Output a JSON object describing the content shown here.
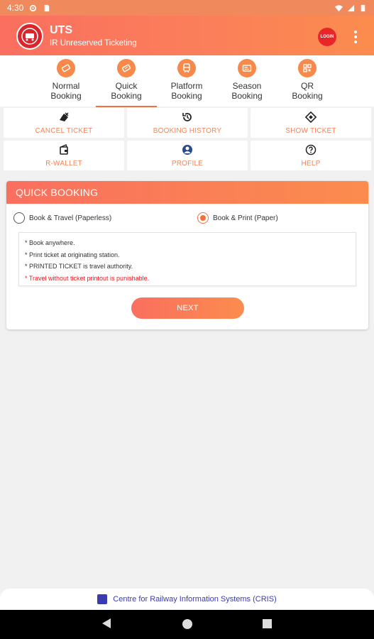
{
  "status_bar": {
    "time": "4:30",
    "icons": [
      "settings-icon",
      "sd-card-icon",
      "wifi-icon",
      "signal-icon",
      "battery-icon"
    ]
  },
  "app_bar": {
    "title": "UTS",
    "subtitle": "IR Unreserved Ticketing",
    "login_label": "LOGIN",
    "logo_icon": "indian-railways-logo",
    "more_icon": "more-vert-icon"
  },
  "tabs": [
    {
      "label": "Normal Booking",
      "line1": "Normal",
      "line2": "Booking",
      "icon": "ticket-icon",
      "active": false
    },
    {
      "label": "Quick Booking",
      "line1": "Quick",
      "line2": "Booking",
      "icon": "quick-ticket-icon",
      "active": true
    },
    {
      "label": "Platform Booking",
      "line1": "Platform",
      "line2": "Booking",
      "icon": "train-icon",
      "active": false
    },
    {
      "label": "Season Booking",
      "line1": "Season",
      "line2": "Booking",
      "icon": "season-card-icon",
      "active": false
    },
    {
      "label": "QR Booking",
      "line1": "QR",
      "line2": "Booking",
      "icon": "qr-code-icon",
      "active": false
    }
  ],
  "actions": [
    {
      "label": "CANCEL TICKET",
      "icon": "cancel-ticket-icon"
    },
    {
      "label": "BOOKING HISTORY",
      "icon": "history-icon"
    },
    {
      "label": "SHOW TICKET",
      "icon": "show-ticket-icon"
    },
    {
      "label": "R-WALLET",
      "icon": "wallet-icon"
    },
    {
      "label": "PROFILE",
      "icon": "profile-icon"
    },
    {
      "label": "HELP",
      "icon": "help-icon"
    }
  ],
  "quick_booking": {
    "header": "QUICK BOOKING",
    "option_paperless": "Book & Travel (Paperless)",
    "option_paper": "Book & Print (Paper)",
    "selected": "paper",
    "info": [
      "* Book anywhere.",
      "* Print ticket at originating station.",
      "* PRINTED TICKET is travel authority.",
      "* Travel without ticket printout is punishable."
    ],
    "next_label": "NEXT"
  },
  "footer": {
    "text": "Centre for Railway Information Systems (CRIS)"
  },
  "colors": {
    "accent": "#f0703e",
    "gradient_start": "#fa6f5f",
    "gradient_end": "#fb8c4e",
    "warning_text": "#e31b23",
    "footer_link": "#3b3bb0"
  }
}
